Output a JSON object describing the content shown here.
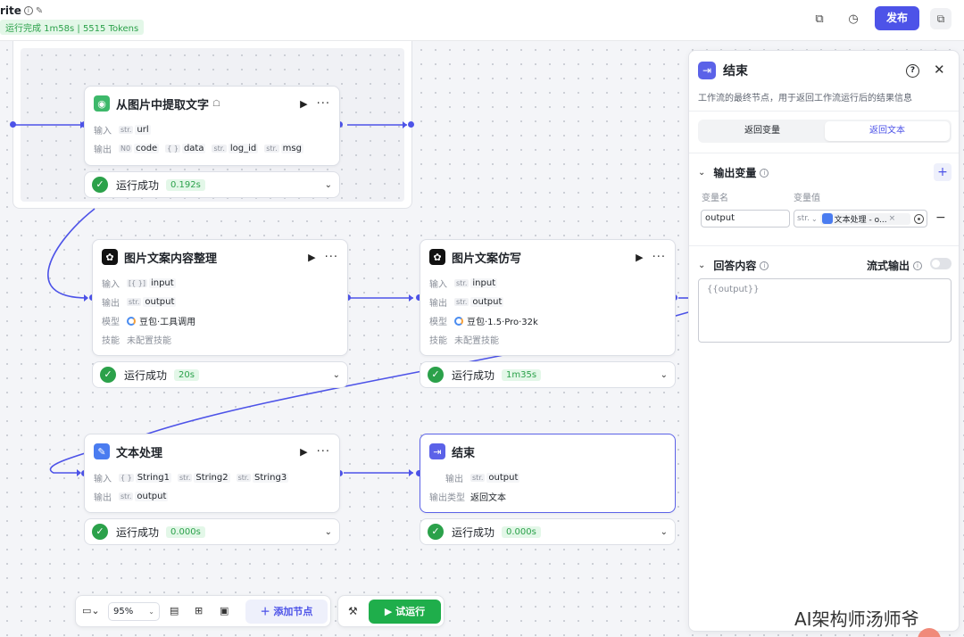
{
  "app": {
    "title": "rite",
    "run_status": "运行完成 1m58s | 5515 Tokens",
    "publish_label": "发布"
  },
  "nodes": {
    "extract": {
      "title": "从图片中提取文字",
      "input_label": "输入",
      "output_label": "输出",
      "inputs": [
        {
          "type": "str.",
          "name": "url"
        }
      ],
      "outputs": [
        {
          "type": "N0",
          "name": "code"
        },
        {
          "type": "{ }",
          "name": "data"
        },
        {
          "type": "str.",
          "name": "log_id"
        },
        {
          "type": "str.",
          "name": "msg"
        }
      ],
      "status": "运行成功",
      "time": "0.192s"
    },
    "organize": {
      "title": "图片文案内容整理",
      "input_label": "输入",
      "output_label": "输出",
      "model_label": "模型",
      "skill_label": "技能",
      "inputs": [
        {
          "type": "[{ }]",
          "name": "input"
        }
      ],
      "outputs": [
        {
          "type": "str.",
          "name": "output"
        }
      ],
      "model": "豆包·工具调用",
      "skill": "未配置技能",
      "status": "运行成功",
      "time": "20s"
    },
    "rewrite": {
      "title": "图片文案仿写",
      "input_label": "输入",
      "output_label": "输出",
      "model_label": "模型",
      "skill_label": "技能",
      "inputs": [
        {
          "type": "str.",
          "name": "input"
        }
      ],
      "outputs": [
        {
          "type": "str.",
          "name": "output"
        }
      ],
      "model": "豆包·1.5·Pro·32k",
      "skill": "未配置技能",
      "status": "运行成功",
      "time": "1m35s"
    },
    "text_process": {
      "title": "文本处理",
      "input_label": "输入",
      "output_label": "输出",
      "inputs": [
        {
          "type": "{ }",
          "name": "String1"
        },
        {
          "type": "str.",
          "name": "String2"
        },
        {
          "type": "str.",
          "name": "String3"
        }
      ],
      "outputs": [
        {
          "type": "str.",
          "name": "output"
        }
      ],
      "status": "运行成功",
      "time": "0.000s"
    },
    "end": {
      "title": "结束",
      "output_label": "输出",
      "output_type_label": "输出类型",
      "outputs": [
        {
          "type": "str.",
          "name": "output"
        }
      ],
      "output_type": "返回文本",
      "status": "运行成功",
      "time": "0.000s"
    }
  },
  "panel": {
    "title": "结束",
    "description": "工作流的最终节点，用于返回工作流运行后的结果信息",
    "tabs": [
      "返回变量",
      "返回文本"
    ],
    "active_tab": 1,
    "output_vars_label": "输出变量",
    "col_var_name": "变量名",
    "col_var_value": "变量值",
    "var_name": "output",
    "var_type": "str.",
    "var_ref": "文本处理 - o...",
    "answer_label": "回答内容",
    "stream_label": "流式输出",
    "answer_content": "{{output}}"
  },
  "toolbar": {
    "zoom": "95%",
    "add_node_label": "添加节点",
    "test_run_label": "试运行"
  },
  "watermark": "AI架构师汤师爷",
  "colors": {
    "accent": "#4d53e8",
    "success": "#2ba14a",
    "run_button": "#1fae4b"
  }
}
